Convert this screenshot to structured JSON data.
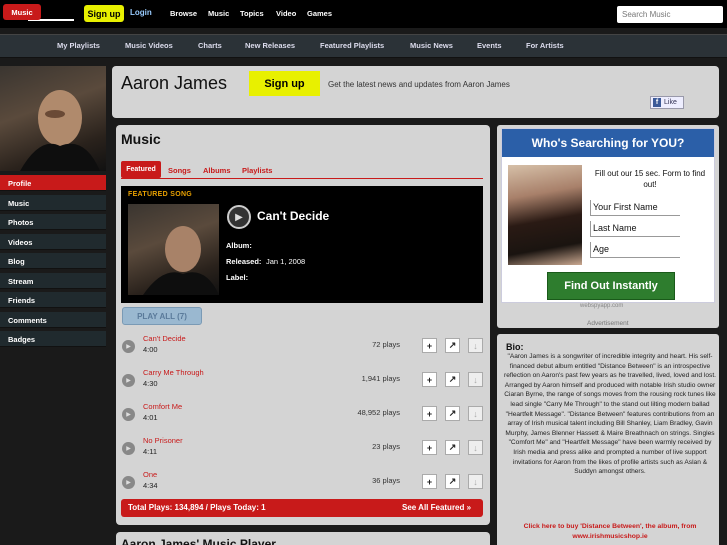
{
  "topbar": {
    "logo": "my",
    "signup": "Sign up",
    "login": "Login",
    "nav": [
      "Browse",
      "Music",
      "Topics",
      "Video",
      "Games"
    ],
    "search_placeholder": "Search Music"
  },
  "mainnav": {
    "items": [
      "Music",
      "My Playlists",
      "Music Videos",
      "Charts",
      "New Releases",
      "Featured Playlists",
      "Music News",
      "Events",
      "For Artists"
    ],
    "active": "Music"
  },
  "sidebar": {
    "items": [
      "Profile",
      "Music",
      "Photos",
      "Videos",
      "Blog",
      "Stream",
      "Friends",
      "Comments",
      "Badges"
    ],
    "active": "Profile"
  },
  "header": {
    "artist_name": "Aaron James",
    "signup": "Sign up",
    "tagline": "Get the latest news and updates from Aaron James",
    "like": "Like"
  },
  "music": {
    "title": "Music",
    "tabs": [
      "Featured",
      "Songs",
      "Albums",
      "Playlists"
    ],
    "featured": {
      "label": "FEATURED SONG",
      "song": "Can't Decide",
      "album_label": "Album:",
      "released_label": "Released:",
      "released": "Jan 1, 2008",
      "label_label": "Label:"
    },
    "play_all": "PLAY ALL (7)",
    "tracks": [
      {
        "title": "Can't Decide",
        "duration": "4:00",
        "plays": "72 plays"
      },
      {
        "title": "Carry Me Through",
        "duration": "4:30",
        "plays": "1,941 plays"
      },
      {
        "title": "Comfort Me",
        "duration": "4:01",
        "plays": "48,952 plays"
      },
      {
        "title": "No Prisoner",
        "duration": "4:11",
        "plays": "23 plays"
      },
      {
        "title": "One",
        "duration": "4:34",
        "plays": "36 plays"
      }
    ],
    "totals": "Total Plays: 134,894 / Plays Today: 1",
    "see_all": "See All Featured »",
    "player_title": "Aaron James' Music Player"
  },
  "ad": {
    "heading": "Who's Searching for YOU?",
    "copy": "Fill out our 15 sec. Form to find out!",
    "fields": [
      "Your First Name",
      "Last Name",
      "Age"
    ],
    "button": "Find Out Instantly",
    "source": "webspyapp.com",
    "advert_label": "Advertisement"
  },
  "bio": {
    "title": "Bio:",
    "text": "\"Aaron James is a songwriter of incredible integrity and heart. His self-financed debut album entitled \"Distance Between\" is an introspective reflection on Aaron's past few years as he travelled, lived, loved and lost. Arranged by Aaron himself and produced with notable Irish studio owner Ciaran Byrne, the range of songs moves from the rousing rock tunes like lead single \"Carry Me Through\" to the stand out lilting modern ballad \"Heartfelt Message\". \"Distance Between\" features contributions from an array of Irish musical talent including Bill Shanley, Liam Bradley, Gavin Murphy, James Blenner Hassett & Maire Breathnach on strings. Singles \"Comfort Me\" and \"Heartfelt Message\" have been warmly received by Irish media and press alike and prompted a number of live support invitations for Aaron from the likes of profile artists such as Aslan & Suddyn amongst others.",
    "link": "Click here to buy 'Distance Between', the album, from www.irishmusicshop.ie"
  }
}
